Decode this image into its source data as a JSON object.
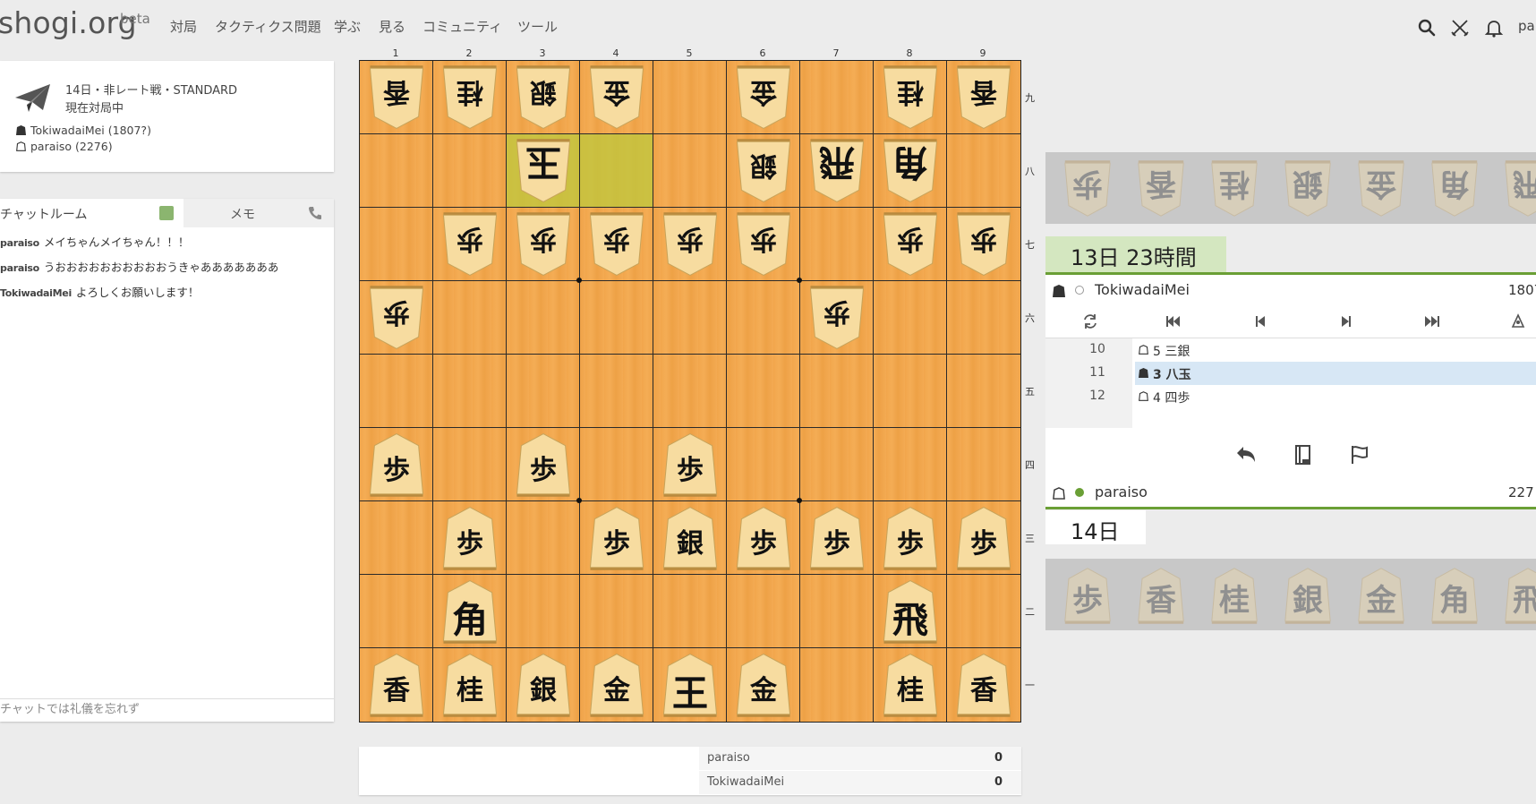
{
  "nav": {
    "logo": "shogi.org",
    "beta": "beta",
    "items": [
      "対局",
      "タクティクス問題",
      "学ぶ",
      "見る",
      "コミュニティ",
      "ツール"
    ],
    "user": "pa"
  },
  "game": {
    "title": "14日・非レート戦・STANDARD",
    "status": "現在対局中",
    "sente": "TokiwadaiMei (1807?)",
    "gote": "paraiso (2276)"
  },
  "chat": {
    "tab_chat": "チャットルーム",
    "tab_memo": "メモ",
    "messages": [
      {
        "user": "paraiso",
        "text": "メイちゃんメイちゃん！！！"
      },
      {
        "user": "paraiso",
        "text": "うおおおおおおおおおおうきゃあああああああ"
      },
      {
        "user": "TokiwadaiMei",
        "text": "よろしくお願いします！"
      }
    ],
    "placeholder": "チャットでは礼儀を忘れず"
  },
  "board": {
    "col_labels": [
      "1",
      "2",
      "3",
      "4",
      "5",
      "6",
      "7",
      "8",
      "9"
    ],
    "row_labels": [
      "九",
      "八",
      "七",
      "六",
      "五",
      "四",
      "三",
      "二",
      "一"
    ],
    "highlight": [
      [
        1,
        2
      ],
      [
        1,
        3
      ]
    ],
    "pieces": [
      {
        "r": 0,
        "c": 0,
        "k": "香",
        "o": "gote"
      },
      {
        "r": 0,
        "c": 1,
        "k": "桂",
        "o": "gote"
      },
      {
        "r": 0,
        "c": 2,
        "k": "銀",
        "o": "gote"
      },
      {
        "r": 0,
        "c": 3,
        "k": "金",
        "o": "gote"
      },
      {
        "r": 0,
        "c": 5,
        "k": "金",
        "o": "gote"
      },
      {
        "r": 0,
        "c": 7,
        "k": "桂",
        "o": "gote"
      },
      {
        "r": 0,
        "c": 8,
        "k": "香",
        "o": "gote"
      },
      {
        "r": 1,
        "c": 2,
        "k": "玉",
        "o": "gote",
        "big": true
      },
      {
        "r": 1,
        "c": 5,
        "k": "銀",
        "o": "gote"
      },
      {
        "r": 1,
        "c": 6,
        "k": "飛",
        "o": "gote",
        "big": true
      },
      {
        "r": 1,
        "c": 7,
        "k": "角",
        "o": "gote",
        "big": true
      },
      {
        "r": 2,
        "c": 1,
        "k": "歩",
        "o": "gote"
      },
      {
        "r": 2,
        "c": 2,
        "k": "歩",
        "o": "gote"
      },
      {
        "r": 2,
        "c": 3,
        "k": "歩",
        "o": "gote"
      },
      {
        "r": 2,
        "c": 4,
        "k": "歩",
        "o": "gote"
      },
      {
        "r": 2,
        "c": 5,
        "k": "歩",
        "o": "gote"
      },
      {
        "r": 2,
        "c": 7,
        "k": "歩",
        "o": "gote"
      },
      {
        "r": 2,
        "c": 8,
        "k": "歩",
        "o": "gote"
      },
      {
        "r": 3,
        "c": 0,
        "k": "歩",
        "o": "gote"
      },
      {
        "r": 3,
        "c": 6,
        "k": "歩",
        "o": "gote"
      },
      {
        "r": 5,
        "c": 0,
        "k": "歩",
        "o": "sente"
      },
      {
        "r": 5,
        "c": 2,
        "k": "歩",
        "o": "sente"
      },
      {
        "r": 5,
        "c": 4,
        "k": "歩",
        "o": "sente"
      },
      {
        "r": 6,
        "c": 1,
        "k": "歩",
        "o": "sente"
      },
      {
        "r": 6,
        "c": 3,
        "k": "歩",
        "o": "sente"
      },
      {
        "r": 6,
        "c": 4,
        "k": "銀",
        "o": "sente"
      },
      {
        "r": 6,
        "c": 5,
        "k": "歩",
        "o": "sente"
      },
      {
        "r": 6,
        "c": 6,
        "k": "歩",
        "o": "sente"
      },
      {
        "r": 6,
        "c": 7,
        "k": "歩",
        "o": "sente"
      },
      {
        "r": 6,
        "c": 8,
        "k": "歩",
        "o": "sente"
      },
      {
        "r": 7,
        "c": 1,
        "k": "角",
        "o": "sente",
        "big": true
      },
      {
        "r": 7,
        "c": 7,
        "k": "飛",
        "o": "sente",
        "big": true
      },
      {
        "r": 8,
        "c": 0,
        "k": "香",
        "o": "sente"
      },
      {
        "r": 8,
        "c": 1,
        "k": "桂",
        "o": "sente"
      },
      {
        "r": 8,
        "c": 2,
        "k": "銀",
        "o": "sente"
      },
      {
        "r": 8,
        "c": 3,
        "k": "金",
        "o": "sente"
      },
      {
        "r": 8,
        "c": 4,
        "k": "王",
        "o": "sente",
        "big": true
      },
      {
        "r": 8,
        "c": 5,
        "k": "金",
        "o": "sente"
      },
      {
        "r": 8,
        "c": 7,
        "k": "桂",
        "o": "sente"
      },
      {
        "r": 8,
        "c": 8,
        "k": "香",
        "o": "sente"
      }
    ]
  },
  "scores": [
    {
      "name": "paraiso",
      "value": "0"
    },
    {
      "name": "TokiwadaiMei",
      "value": "0"
    }
  ],
  "panel": {
    "gote_hand": [
      "歩",
      "香",
      "桂",
      "銀",
      "金",
      "角",
      "飛"
    ],
    "sente_hand": [
      "歩",
      "香",
      "桂",
      "銀",
      "金",
      "角",
      "飛"
    ],
    "clock_top": "13日 23時間",
    "top_player": {
      "name": "TokiwadaiMei",
      "rating": "1807"
    },
    "moves": [
      {
        "num": "10",
        "text": "5 三銀",
        "side": "gote"
      },
      {
        "num": "11",
        "text": "3 八玉",
        "side": "sente",
        "selected": true
      },
      {
        "num": "12",
        "text": "4 四歩",
        "side": "gote"
      }
    ],
    "bottom_player": {
      "name": "paraiso",
      "rating": "227"
    },
    "clock_bottom": "14日"
  },
  "colors": {
    "accent_green": "#6a9f35",
    "board": "#f2a64c",
    "online": "#8bb56f"
  }
}
